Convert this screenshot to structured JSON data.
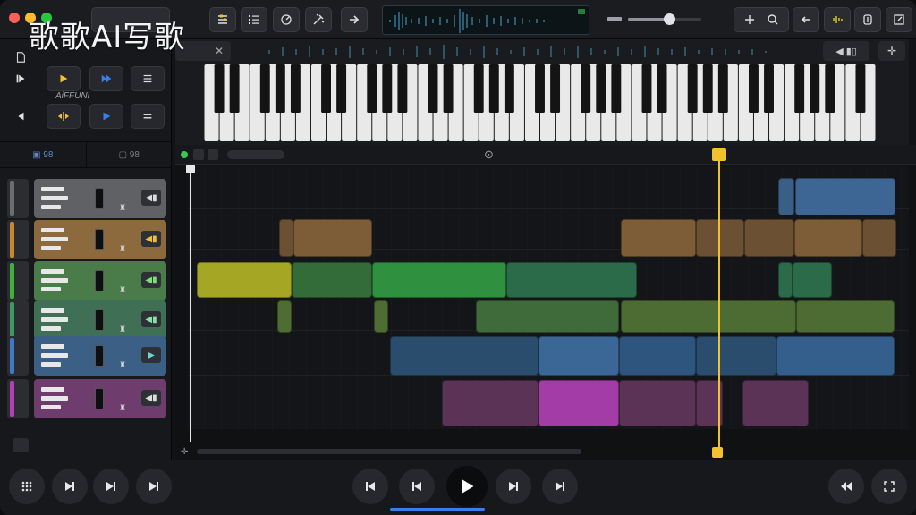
{
  "watermark": "歌歌AI写歌",
  "left_panel": {
    "subtitle": "AiFFUNI",
    "tabs": [
      {
        "label": "▣ 98",
        "active": true
      },
      {
        "label": "▢ 98",
        "active": false
      }
    ]
  },
  "tracks": [
    {
      "color": "#8d8f94",
      "strip": "#8d8f94",
      "body": "#5f6165"
    },
    {
      "color": "#c7892f",
      "strip": "#c7892f",
      "body": "#8c6a3e"
    },
    {
      "color": "#3fb03a",
      "strip": "#3fb03a",
      "body": "#4a7c4a"
    },
    {
      "color": "#3b9a60",
      "strip": "#3b9a60",
      "body": "#3f6f55"
    },
    {
      "color": "#3f7ac9",
      "strip": "#3f7ac9",
      "body": "#3c5f86"
    },
    {
      "color": "#b23fb6",
      "strip": "#b23fb6",
      "body": "#6e3d6e"
    }
  ],
  "colors": {
    "accent_yellow": "#f2c12e",
    "accent_blue": "#3a7ee8",
    "play": "#ffffff"
  },
  "icons": [
    "close-dot",
    "minimize-dot",
    "maximize-dot",
    "mixer-icon",
    "list-icon",
    "metronome-icon",
    "wand-icon",
    "arrow-right-icon",
    "volume-icon",
    "plus-icon",
    "zoom-icon",
    "back-icon",
    "levels-icon",
    "tuner-icon",
    "fullscreen-icon",
    "play-icon",
    "skip-icon",
    "rewind-icon",
    "grid-icon"
  ]
}
